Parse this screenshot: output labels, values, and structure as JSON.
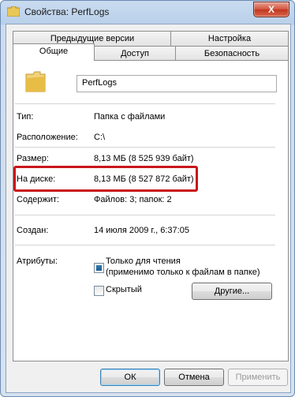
{
  "window": {
    "title": "Свойства: PerfLogs",
    "close_glyph": "X"
  },
  "tabs": {
    "top_row": [
      "Предыдущие версии",
      "Настройка"
    ],
    "bottom_row": [
      "Общие",
      "Доступ",
      "Безопасность"
    ],
    "active": "Общие"
  },
  "general": {
    "folder_name": "PerfLogs",
    "type_label": "Тип:",
    "type_value": "Папка с файлами",
    "location_label": "Расположение:",
    "location_value": "C:\\",
    "size_label": "Размер:",
    "size_value": "8,13 МБ (8 525 939 байт)",
    "ondisk_label": "На диске:",
    "ondisk_value": "8,13 МБ (8 527 872 байт)",
    "contains_label": "Содержит:",
    "contains_value": "Файлов: 3; папок: 2",
    "created_label": "Создан:",
    "created_value": "14 июля 2009 г., 6:37:05",
    "attributes_label": "Атрибуты:",
    "readonly_label_line1": "Только для чтения",
    "readonly_label_line2": "(применимо только к файлам в папке)",
    "hidden_label": "Скрытый",
    "other_button": "Другие..."
  },
  "footer": {
    "ok": "ОК",
    "cancel": "Отмена",
    "apply": "Применить"
  },
  "colors": {
    "highlight": "#c8161b",
    "accent": "#1e5c8e"
  }
}
